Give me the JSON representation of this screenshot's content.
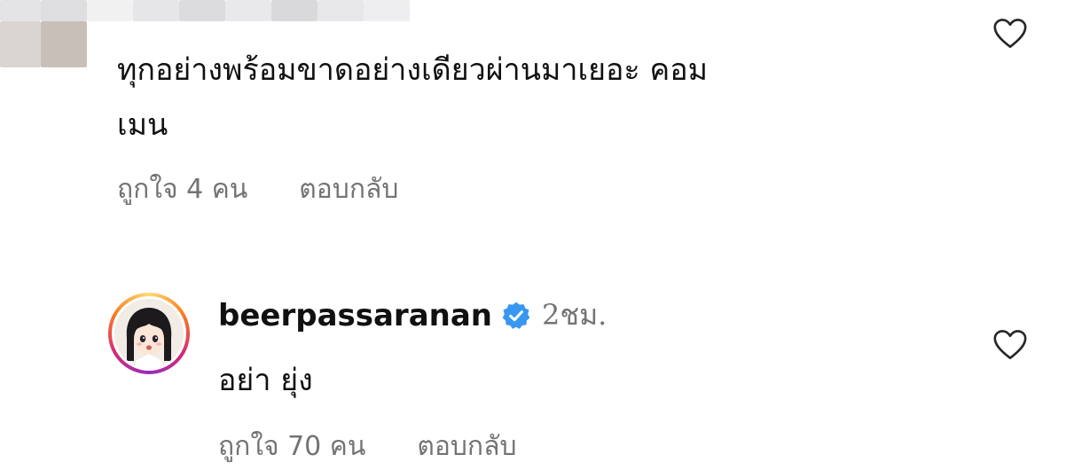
{
  "comment_1": {
    "text_line_1": "ทุกอย่างพร้อมขาดอย่างเดียวผ่านมาเยอะ คอม",
    "text_line_2": "เมน",
    "likes": "ถูกใจ 4 คน",
    "reply": "ตอบกลับ",
    "like_icon": "heart-outline-icon"
  },
  "comment_2": {
    "username": "beerpassaranan",
    "verified_icon": "verified-badge-icon",
    "time": "2ชม.",
    "text": "อย่า ยุ่ง",
    "likes": "ถูกใจ 70 คน",
    "reply": "ตอบกลับ",
    "like_icon": "heart-outline-icon"
  },
  "colors": {
    "text": "#111111",
    "secondary_text": "#737373",
    "verified": "#3897f0",
    "story_ring": [
      "#feda75",
      "#fa7e1e",
      "#d62976",
      "#962fbf"
    ]
  }
}
